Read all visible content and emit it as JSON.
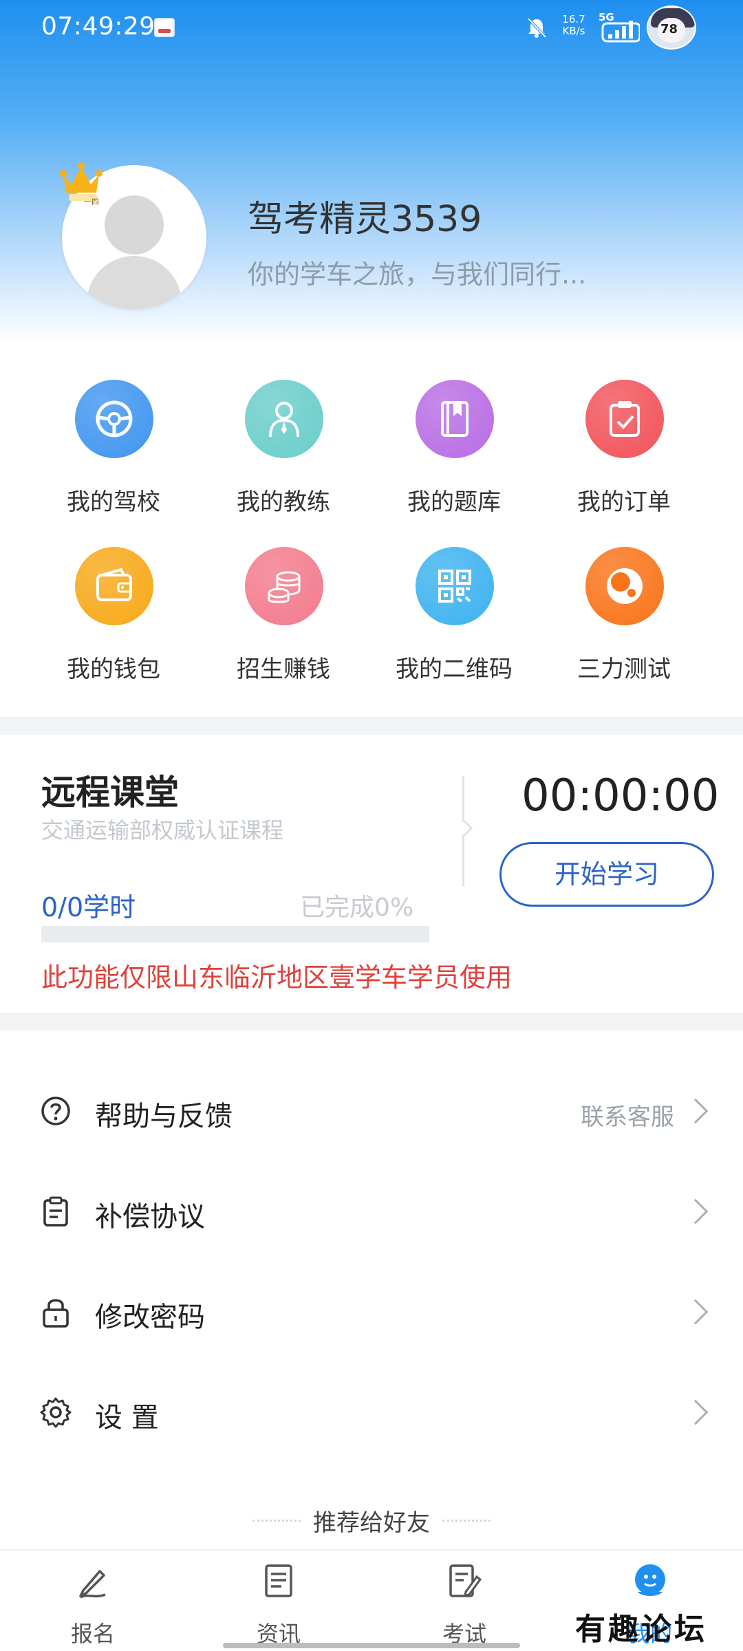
{
  "status_bar": {
    "time": "07:49:29",
    "speed_value": "16.7",
    "speed_unit": "KB/s",
    "network": "5G",
    "battery": "78"
  },
  "profile": {
    "username": "驾考精灵3539",
    "tagline": "你的学车之旅，与我们同行...",
    "badge": "一四"
  },
  "grid": [
    {
      "label": "我的驾校",
      "icon": "steering-wheel-icon",
      "color": "#3f95f0"
    },
    {
      "label": "我的教练",
      "icon": "coach-person-icon",
      "color": "#69cdca"
    },
    {
      "label": "我的题库",
      "icon": "question-book-icon",
      "color": "#b86ce4"
    },
    {
      "label": "我的订单",
      "icon": "order-clipboard-icon",
      "color": "#f2525a"
    },
    {
      "label": "我的钱包",
      "icon": "wallet-icon",
      "color": "#f7a817"
    },
    {
      "label": "招生赚钱",
      "icon": "coins-icon",
      "color": "#f27a8c"
    },
    {
      "label": "我的二维码",
      "icon": "qr-code-icon",
      "color": "#3cb2ef"
    },
    {
      "label": "三力测试",
      "icon": "three-ability-test-icon",
      "color": "#f97318"
    }
  ],
  "remote_class": {
    "title": "远程课堂",
    "subtitle": "交通运输部权威认证课程",
    "timer": "00:00:00",
    "button_label": "开始学习",
    "hours": "0/0学时",
    "completed": "已完成0%",
    "progress": 0,
    "notice": "此功能仅限山东临沂地区壹学车学员使用"
  },
  "menu": [
    {
      "label": "帮助与反馈",
      "extra": "联系客服",
      "icon": "help-icon"
    },
    {
      "label": "补偿协议",
      "extra": "",
      "icon": "clipboard-icon"
    },
    {
      "label": "修改密码",
      "extra": "",
      "icon": "lock-icon"
    },
    {
      "label": "设 置",
      "extra": "",
      "icon": "settings-gear-icon"
    }
  ],
  "recommend": "推荐给好友",
  "bottom_nav": [
    {
      "label": "报名",
      "icon": "signup-icon",
      "active": false
    },
    {
      "label": "资讯",
      "icon": "news-icon",
      "active": false
    },
    {
      "label": "考试",
      "icon": "exam-icon",
      "active": false
    },
    {
      "label": "我的",
      "icon": "profile-icon",
      "active": true
    }
  ],
  "watermark": "有趣论坛",
  "colors": {
    "accent": "#2a64c8",
    "active_nav": "#1f90f0",
    "notice_red": "#e0413b"
  }
}
